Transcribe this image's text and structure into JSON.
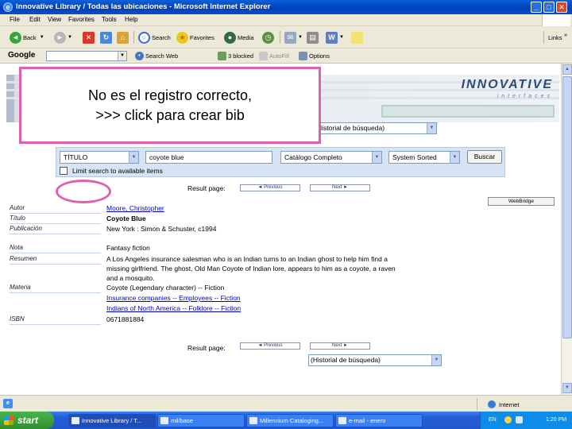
{
  "window": {
    "title": "Innovative Library / Todas las ubicaciones - Microsoft Internet Explorer",
    "minimize": "_",
    "maximize": "□",
    "close": "✕"
  },
  "menu": {
    "items": [
      "File",
      "Edit",
      "View",
      "Favorites",
      "Tools",
      "Help"
    ]
  },
  "toolbar": {
    "back": "Back",
    "search": "Search",
    "favorites": "Favorites",
    "media": "Media",
    "links": "Links",
    "more": "»"
  },
  "google": {
    "logo": "Google",
    "search_web": "Search Web",
    "blocked": "3 blocked",
    "autofill": "AutoFill",
    "options": "Options"
  },
  "annotation": {
    "note_line1": "No es el registro correcto,",
    "note_line2": ">>> click para crear bib"
  },
  "page": {
    "brand": "INNOVATIVE",
    "brand_sub": "interfaces",
    "history_top": "Historial de búsqueda)",
    "search": {
      "index": "TÍTULO",
      "query": "coyote blue",
      "scope": "Catálogo Completo",
      "sort": "System Sorted",
      "button": "Buscar",
      "limit": "Limit search to available items"
    },
    "result_page_label": "Result page:",
    "previous": "◄ Previous",
    "next": "Next ►",
    "webbridge": "WebBridge",
    "history_bottom": "(Historial de búsqueda)",
    "record": {
      "author_label": "Autor",
      "author": "Moore, Christopher",
      "title_label": "Título",
      "title": "Coyote Blue",
      "pub_label": "Publicación",
      "pub": "New York : Simon & Schuster, c1994",
      "note_label": "Nota",
      "note": "Fantasy fiction",
      "summary_label": "Resumen",
      "summary": [
        "A Los Angeles insurance salesman who is an Indian turns to an Indian ghost to help him find a",
        "missing girlfriend. The ghost, Old Man Coyote of Indian lore, appears to him as a coyote, a raven",
        "and a mosquito."
      ],
      "subject_label": "Materia",
      "subjects": [
        "Coyote (Legendary character) -- Fiction",
        "Insurance companies -- Employees -- Fiction",
        "Indians of North America -- Folklore -- Fiction"
      ],
      "isbn_label": "ISBN",
      "isbn": "0671881884"
    }
  },
  "status": {
    "zone": "Internet"
  },
  "taskbar": {
    "start": "start",
    "tasks": [
      "Innovative Library / T...",
      "mil/base",
      "Millennium Cataloging...",
      "e-mail - enero"
    ],
    "lang": "EN",
    "time": "1:20 PM"
  }
}
